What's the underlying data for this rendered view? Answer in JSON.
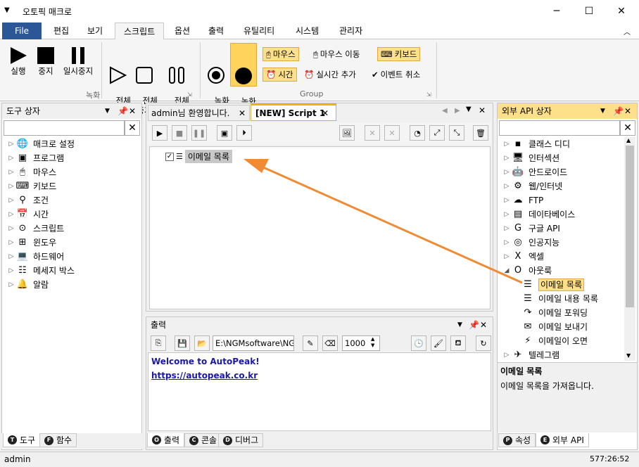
{
  "window": {
    "title": "오토픽 매크로",
    "minimize": "─",
    "maximize": "☐",
    "close": "✕"
  },
  "menu": {
    "items": [
      "File",
      "편집",
      "보기",
      "스크립트",
      "옵션",
      "출력",
      "유틸리티",
      "시스템",
      "관리자"
    ],
    "active": "스크립트"
  },
  "ribbon": {
    "record_buttons": [
      "실행",
      "중지",
      "일시중지"
    ],
    "all_run": "전체\n실행",
    "all_stop": "전체\n중지",
    "all_pause": "전체\n일시중지",
    "rec_start": "녹화\n시작",
    "rec_stop": "녹화\n중지",
    "group_record": "녹화",
    "group_group": "Group",
    "chips": {
      "mouse": "마우스",
      "mouse_move": "마우스 이동",
      "keyboard": "키보드",
      "time": "시간",
      "realtime_add": "실시간 추가",
      "event_cancel": "이벤트 취소"
    }
  },
  "left_panel": {
    "title": "도구 상자",
    "items": [
      "매크로 설정",
      "프로그램",
      "마우스",
      "키보드",
      "조건",
      "시간",
      "스크립트",
      "윈도우",
      "하드웨어",
      "메세지 박스",
      "알람"
    ],
    "icons": [
      "globe-icon",
      "program-icon",
      "mouse-icon",
      "keyboard-icon",
      "condition-icon",
      "calendar-icon",
      "script-icon",
      "window-icon",
      "laptop-icon",
      "messagebox-icon",
      "bell-icon"
    ],
    "tabs": [
      "도구",
      "함수"
    ],
    "tab_letters": [
      "T",
      "F"
    ]
  },
  "editor": {
    "tabs": [
      "admin님 환영합니다.",
      "[NEW] Script 1"
    ],
    "active_tab": "[NEW] Script 1",
    "script_item": "이메일 목록"
  },
  "output": {
    "title": "출력",
    "path": "E:\\NGMsoftware\\NG",
    "interval": "1000",
    "line1": "Welcome to AutoPeak!",
    "line2": "https://autopeak.co.kr",
    "tabs": [
      "출력",
      "콘솔",
      "디버그"
    ],
    "tab_letters": [
      "O",
      "C",
      "D"
    ]
  },
  "right_panel": {
    "title": "외부 API 상자",
    "items": [
      "클래스 디디",
      "인터섹션",
      "안드로이드",
      "웹/인터넷",
      "FTP",
      "데이타베이스",
      "구글 API",
      "인공지능",
      "엑셀",
      "아웃룩"
    ],
    "sub_items": [
      "이메일 목록",
      "이메일 내용 목록",
      "이메일 포워딩",
      "이메일 보내기",
      "이메일이 오면"
    ],
    "selected": "이메일 목록",
    "desc_title": "이메일 목록",
    "desc_text": "이메일 목록을 가져옵니다.",
    "tabs": [
      "속성",
      "외부 API"
    ],
    "tab_letters": [
      "P",
      "E"
    ]
  },
  "status": {
    "user": "admin",
    "time": "577:26:52"
  },
  "colors": {
    "accent": "#2b5797",
    "highlight": "#ffe08a",
    "arrow": "#f08a33",
    "link": "#1a1aa6"
  }
}
